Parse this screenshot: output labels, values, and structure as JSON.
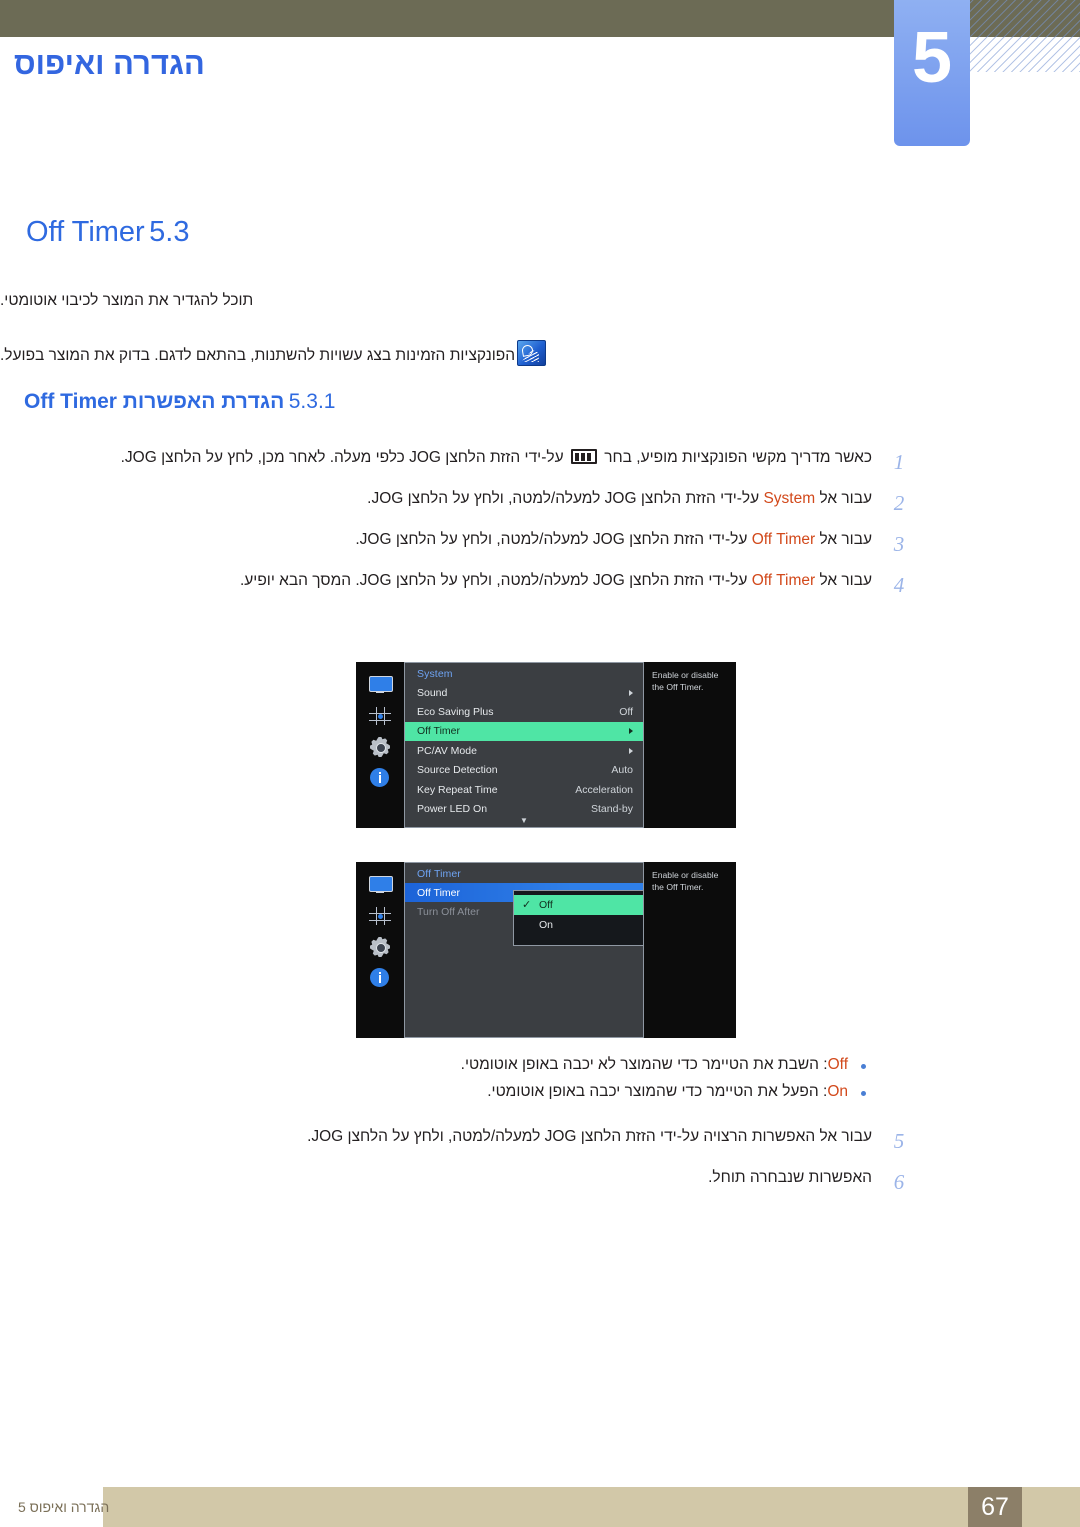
{
  "chapter": {
    "number": "5",
    "title": "הגדרה ואיפוס"
  },
  "section": {
    "number": "5.3",
    "name": "Off Timer"
  },
  "intro": "תוכל להגדיר את המוצר לכיבוי אוטומטי.",
  "note": {
    "icon": "note-hand-icon",
    "text": "הפונקציות הזמינות בצג עשויות להשתנות, בהתאם לדגם. בדוק את המוצר בפועל."
  },
  "subsection": {
    "number": "5.3.1",
    "name": "הגדרת האפשרות Off Timer"
  },
  "steps_upper": [
    {
      "num": "1",
      "pre": "כאשר מדריך מקשי הפונקציות מופיע, בחר ",
      "glyph": "jog-menu-icon",
      "post": " על-ידי הזזת הלחצן JOG כלפי מעלה. לאחר מכן, לחץ על הלחצן JOG."
    },
    {
      "num": "2",
      "pre": "עבור אל ",
      "kw": "System",
      "post": " על-ידי הזזת הלחצן JOG למעלה/למטה, ולחץ על הלחצן JOG."
    },
    {
      "num": "3",
      "pre": "עבור אל ",
      "kw": "Off Timer",
      "post": " על-ידי הזזת הלחצן JOG למעלה/למטה, ולחץ על הלחצן JOG."
    },
    {
      "num": "4",
      "pre": "עבור אל ",
      "kw": "Off Timer",
      "post": " על-ידי הזזת הלחצן JOG למעלה/למטה, ולחץ על הלחצן JOG. המסך הבא יופיע."
    }
  ],
  "steps_lower": [
    {
      "num": "5",
      "pre": "עבור אל האפשרות הרצויה על-ידי הזזת הלחצן JOG למעלה/למטה, ולחץ על הלחצן JOG.",
      "kw": "",
      "post": ""
    },
    {
      "num": "6",
      "pre": "האפשרות שנבחרה תוחל.",
      "kw": "",
      "post": ""
    }
  ],
  "bullets": [
    {
      "kw": "Off",
      "text": ": השבת את הטיימר כדי שהמוצר לא יכבה באופן אוטומטי."
    },
    {
      "kw": "On",
      "text": ": הפעל את הטיימר כדי שהמוצר יכבה באופן אוטומטי."
    }
  ],
  "osd_system": {
    "title": "System",
    "description": "Enable or disable the Off Timer.",
    "rail_icons": [
      "monitor-icon",
      "navigation-cross-icon",
      "gear-icon",
      "info-icon"
    ],
    "rows": [
      {
        "label": "Sound",
        "value": "",
        "arrow": true,
        "state": "normal"
      },
      {
        "label": "Eco Saving Plus",
        "value": "Off",
        "arrow": false,
        "state": "normal"
      },
      {
        "label": "Off Timer",
        "value": "",
        "arrow": true,
        "state": "selected-green"
      },
      {
        "label": "PC/AV Mode",
        "value": "",
        "arrow": true,
        "state": "normal"
      },
      {
        "label": "Source Detection",
        "value": "Auto",
        "arrow": false,
        "state": "normal"
      },
      {
        "label": "Key Repeat Time",
        "value": "Acceleration",
        "arrow": false,
        "state": "normal"
      },
      {
        "label": "Power LED On",
        "value": "Stand-by",
        "arrow": false,
        "state": "normal"
      }
    ],
    "scroll_caret": "▼"
  },
  "osd_offtimer": {
    "title": "Off Timer",
    "description": "Enable or disable the Off Timer.",
    "rail_icons": [
      "monitor-icon",
      "navigation-cross-icon",
      "gear-icon",
      "info-icon"
    ],
    "rows": [
      {
        "label": "Off Timer",
        "value": "",
        "arrow": false,
        "state": "selected-blue"
      },
      {
        "label": "Turn Off After",
        "value": "",
        "arrow": false,
        "state": "dim"
      }
    ],
    "submenu": [
      {
        "label": "Off",
        "checked": true
      },
      {
        "label": "On",
        "checked": false
      }
    ]
  },
  "footer": {
    "label": "הגדרה ואיפוס 5",
    "page": "67"
  },
  "colors": {
    "header_bar": "#6c6b55",
    "chapter_tab": "#7ba0ef",
    "heading_blue": "#2f6ae0",
    "keyword_orange": "#d2491b",
    "osd_green": "#4fe5a5",
    "osd_blue": "#2f7fe8",
    "footer_band": "#d2c8a8",
    "page_box": "#8c7f68"
  }
}
